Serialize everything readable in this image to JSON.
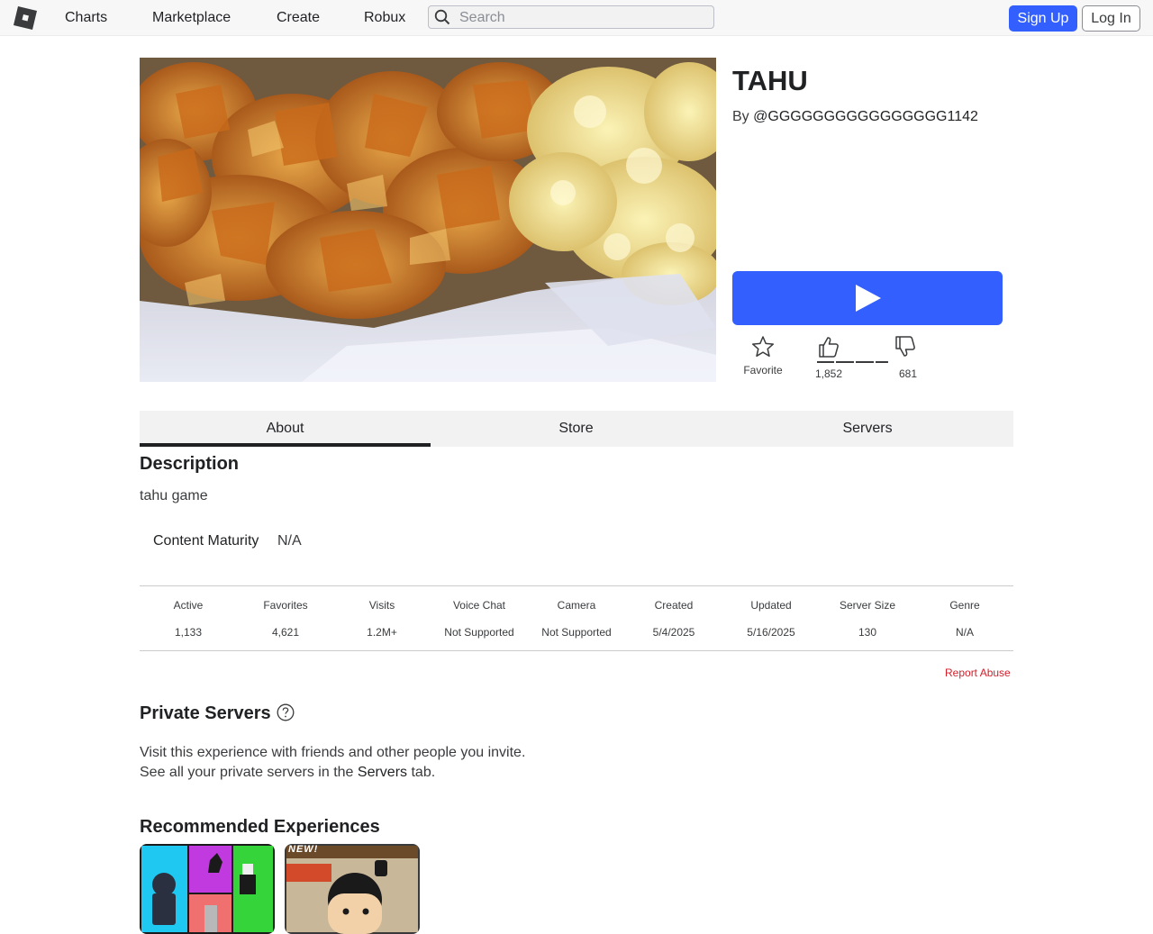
{
  "nav": {
    "links": [
      "Charts",
      "Marketplace",
      "Create",
      "Robux"
    ],
    "search_placeholder": "Search",
    "signup_label": "Sign Up",
    "login_label": "Log In"
  },
  "game": {
    "title": "TAHU",
    "by_label": "By",
    "creator": "@GGGGGGGGGGGGGGGG1142",
    "favorite_label": "Favorite",
    "upvotes": "1,852",
    "downvotes": "681",
    "like_ratio": 0.731
  },
  "tabs": [
    "About",
    "Store",
    "Servers"
  ],
  "about": {
    "description_heading": "Description",
    "description": "tahu game",
    "maturity_label": "Content Maturity",
    "maturity_value": "N/A"
  },
  "stats": [
    {
      "label": "Active",
      "value": "1,133"
    },
    {
      "label": "Favorites",
      "value": "4,621"
    },
    {
      "label": "Visits",
      "value": "1.2M+"
    },
    {
      "label": "Voice Chat",
      "value": "Not Supported"
    },
    {
      "label": "Camera",
      "value": "Not Supported"
    },
    {
      "label": "Created",
      "value": "5/4/2025"
    },
    {
      "label": "Updated",
      "value": "5/16/2025"
    },
    {
      "label": "Server Size",
      "value": "130"
    },
    {
      "label": "Genre",
      "value": "N/A"
    }
  ],
  "report_abuse": "Report Abuse",
  "private_servers": {
    "heading": "Private Servers",
    "line1": "Visit this experience with friends and other people you invite.",
    "line2_before": "See all your private servers in the",
    "line2_strong": "Servers",
    "line2_after": "tab."
  },
  "recommended": {
    "heading": "Recommended Experiences",
    "card2_badge": "NEW!"
  },
  "colors": {
    "accent": "#335fff",
    "report": "#d2212d",
    "text_dark": "#1f2123"
  }
}
